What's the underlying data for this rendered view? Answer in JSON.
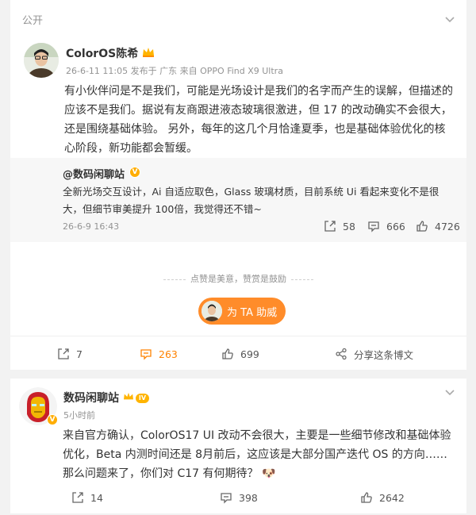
{
  "post1": {
    "visibility": "公开",
    "author": "ColorOS陈希",
    "meta": "26-6-11 11:05  发布于 广东  来自 OPPO Find X9 Ultra",
    "text": "有小伙伴问是不是我们，可能是光场设计是我们的名字而产生的误解，但描述的应该不是我们。据说有友商跟进液态玻璃很激进，但 17 的改动确实不会很大，还是围绕基础体验。 另外，每年的这几个月恰逢夏季，也是基础体验优化的核心阶段，新功能都会暂缓。",
    "repost": {
      "author": "@数码闲聊站",
      "text": "全新光场交互设计，Ai 自适应取色，Glass 玻璃材质，目前系统 Ui 看起来变化不是很大，但细节审美提升 100倍，我觉得还不错~",
      "time": "26-6-9 16:43",
      "reposts": "58",
      "comments": "666",
      "likes": "4726"
    },
    "reward_hint": "点赞是美意，赞赏是鼓励",
    "boost_label": "为 TA 助威",
    "reposts": "7",
    "comments": "263",
    "likes": "699",
    "share_label": "分享这条博文"
  },
  "post2": {
    "author": "数码闲聊站",
    "level": "IV",
    "meta": "5小时前",
    "text": "来自官方确认，ColorOS17 UI 改动不会很大，主要是一些细节修改和基础体验优化，Beta 内测时间还是 8月前后，这应该是大部分国产迭代 OS 的方向……那么问题来了，你们对 C17 有何期待？",
    "emoji": "🐶",
    "reposts": "14",
    "comments": "398",
    "likes": "2642"
  },
  "colors": {
    "accent": "#ff8200",
    "verified": "#ffad00",
    "muted": "#939393"
  },
  "icons": [
    "chevron-down-icon",
    "repost-icon",
    "comment-icon",
    "like-icon",
    "share-icon",
    "verified-icon",
    "crown-icon"
  ]
}
